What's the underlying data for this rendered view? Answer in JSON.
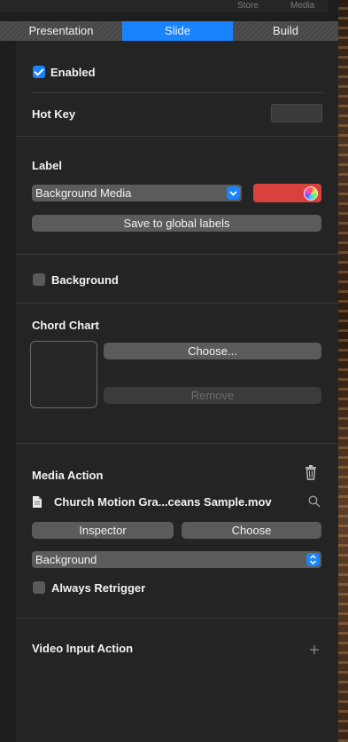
{
  "top_strip": {
    "store": "Store",
    "media": "Media"
  },
  "tabs": [
    {
      "label": "Presentation",
      "active": false
    },
    {
      "label": "Slide",
      "active": true
    },
    {
      "label": "Build",
      "active": false
    }
  ],
  "enabled": {
    "label": "Enabled",
    "checked": true
  },
  "hot_key": {
    "label": "Hot Key"
  },
  "label_section": {
    "title": "Label",
    "selected": "Background Media",
    "color": "#d9413f",
    "save_button": "Save to global labels"
  },
  "background": {
    "label": "Background",
    "checked": false
  },
  "chord_chart": {
    "title": "Chord Chart",
    "choose_button": "Choose...",
    "remove_button": "Remove"
  },
  "media_action": {
    "title": "Media Action",
    "file_name": "Church Motion Gra...ceans Sample.mov",
    "inspector_button": "Inspector",
    "choose_button": "Choose",
    "layer_selected": "Background",
    "always_retrigger": {
      "label": "Always Retrigger",
      "checked": false
    }
  },
  "video_input_action": {
    "title": "Video Input Action"
  },
  "colors": {
    "accent": "#1a84ff",
    "panel": "#242424",
    "label_color": "#d9413f"
  }
}
